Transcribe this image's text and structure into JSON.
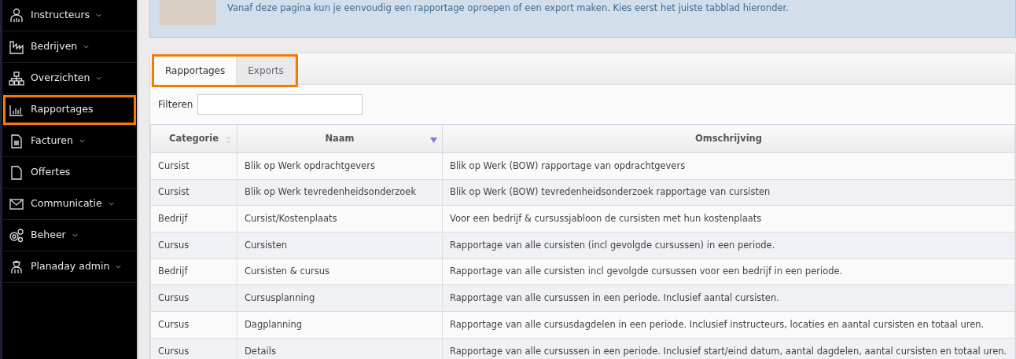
{
  "sidebar": {
    "items": [
      {
        "label": "Instructeurs",
        "has_submenu": true,
        "highlighted": false
      },
      {
        "label": "Bedrijven",
        "has_submenu": true,
        "highlighted": false
      },
      {
        "label": "Overzichten",
        "has_submenu": true,
        "highlighted": false
      },
      {
        "label": "Rapportages",
        "has_submenu": false,
        "highlighted": true
      },
      {
        "label": "Facturen",
        "has_submenu": true,
        "highlighted": false
      },
      {
        "label": "Offertes",
        "has_submenu": false,
        "highlighted": false
      },
      {
        "label": "Communicatie",
        "has_submenu": true,
        "highlighted": false
      },
      {
        "label": "Beheer",
        "has_submenu": true,
        "highlighted": false
      },
      {
        "label": "Planaday admin",
        "has_submenu": true,
        "highlighted": false
      }
    ]
  },
  "banner": {
    "text": "Vanaf deze pagina kun je eenvoudig een rapportage oproepen of een export maken. Kies eerst het juiste tabblad hieronder."
  },
  "tabs": {
    "highlighted": true,
    "items": [
      {
        "label": "Rapportages",
        "selected": true
      },
      {
        "label": "Exports",
        "selected": false
      }
    ]
  },
  "filter": {
    "label": "Filteren"
  },
  "table": {
    "columns": [
      {
        "label": "Categorie",
        "sortable": true,
        "sorted_descending": false
      },
      {
        "label": "Naam",
        "sortable": true,
        "sorted_descending": true
      },
      {
        "label": "Omschrijving"
      }
    ],
    "rows": [
      [
        "Cursist",
        "Blik op Werk opdrachtgevers",
        "Blik op Werk (BOW) rapportage van opdrachtgevers"
      ],
      [
        "Cursist",
        "Blik op Werk tevredenheidsonderzoek",
        "Blik op Werk (BOW) tevredenheidsonderzoek rapportage van cursisten"
      ],
      [
        "Bedrijf",
        "Cursist/Kostenplaats",
        "Voor een bedrijf & cursussjabloon de cursisten met hun kostenplaats"
      ],
      [
        "Cursus",
        "Cursisten",
        "Rapportage van alle cursisten (incl gevolgde cursussen) in een periode."
      ],
      [
        "Bedrijf",
        "Cursisten & cursus",
        "Rapportage van alle cursisten incl gevolgde cursussen voor een bedrijf in een periode."
      ],
      [
        "Cursus",
        "Cursusplanning",
        "Rapportage van alle cursussen in een periode. Inclusief aantal cursisten."
      ],
      [
        "Cursus",
        "Dagplanning",
        "Rapportage van alle cursusdagdelen in een periode. Inclusief instructeurs, locaties en aantal cursisten en totaal uren."
      ],
      [
        "Cursus",
        "Details",
        "Rapportage van alle cursussen in een periode. Inclusief start/eind datum, aantal dagdelen, aantal cursisten en totaal uren."
      ]
    ]
  }
}
